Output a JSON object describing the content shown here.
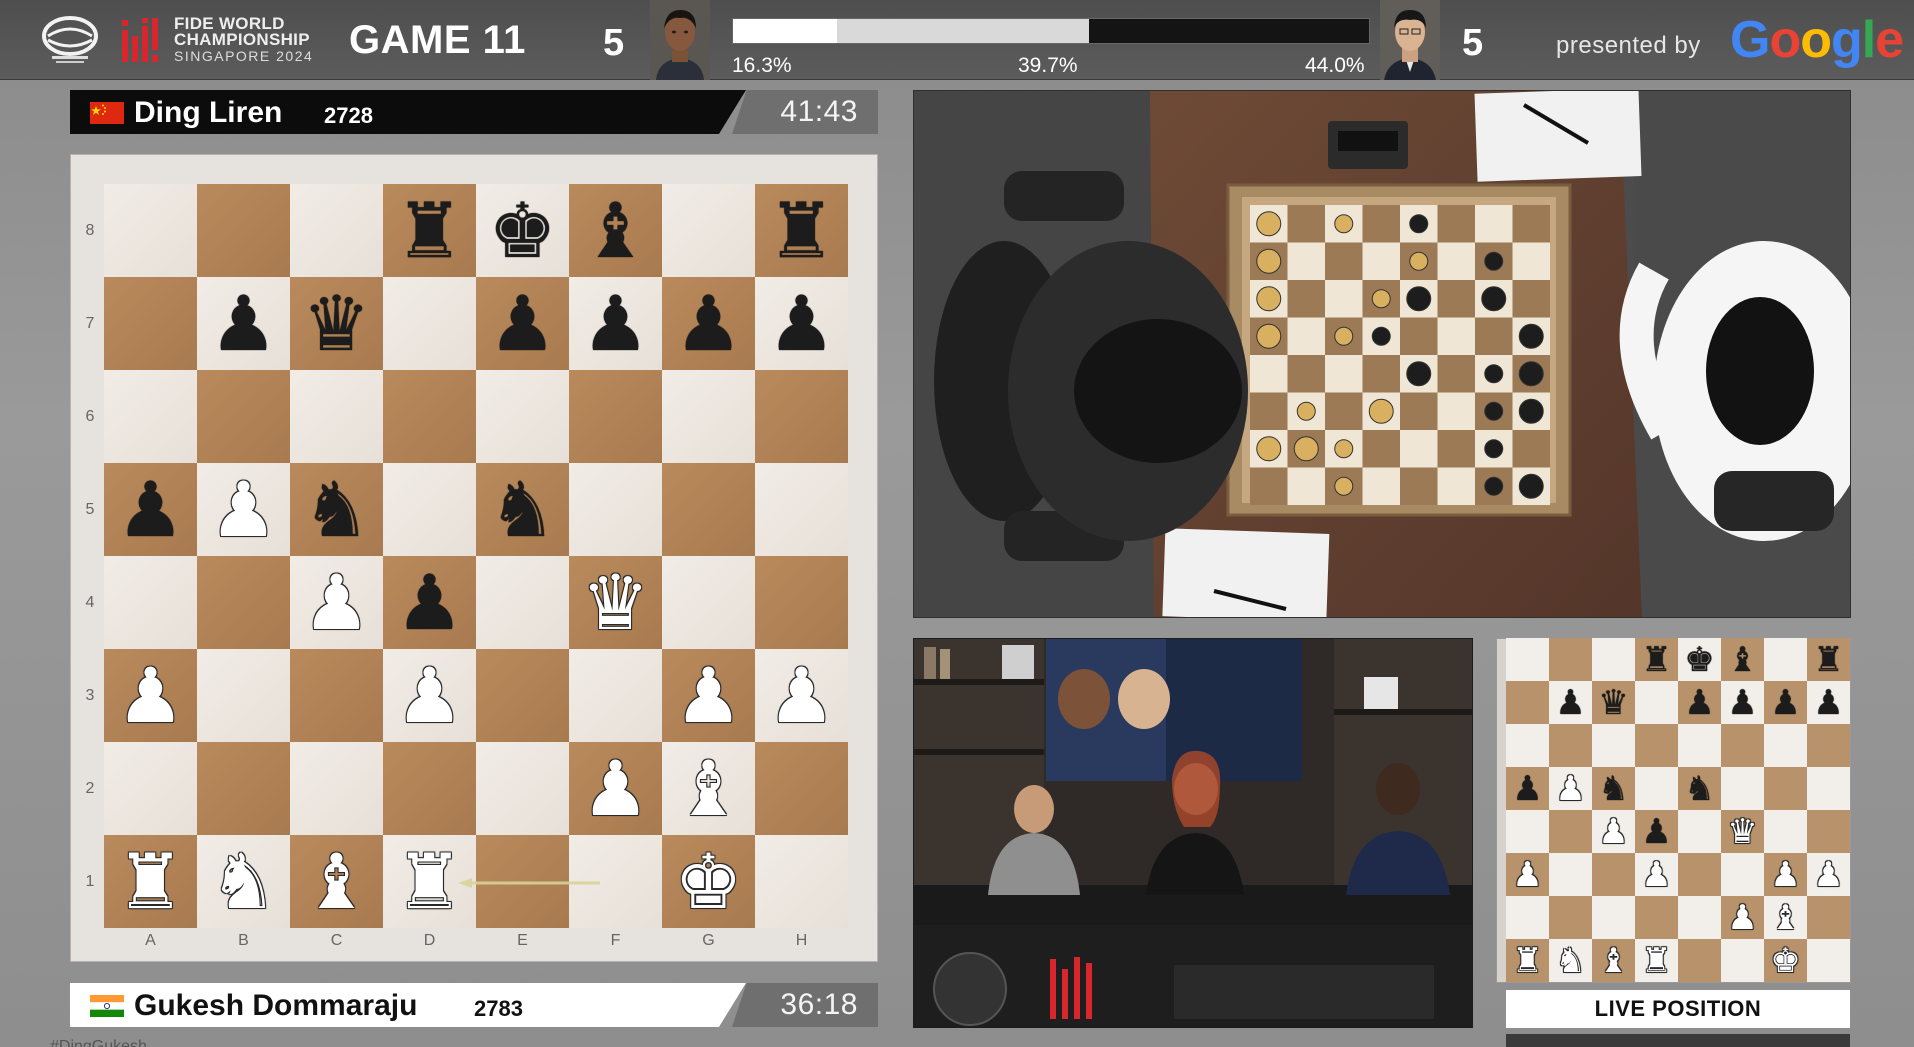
{
  "header": {
    "org_line1": "FIDE WORLD",
    "org_line2": "CHAMPIONSHIP",
    "org_line3": "SINGAPORE 2024",
    "game_label": "GAME 11",
    "score_left": "5",
    "score_right": "5",
    "presented_by": "presented by",
    "sponsor_letters": [
      "G",
      "o",
      "o",
      "g",
      "l",
      "e"
    ]
  },
  "evaluation": {
    "white_win_pct": 16.3,
    "draw_pct": 39.7,
    "black_win_pct": 44.0,
    "white_label": "16.3%",
    "draw_label": "39.7%",
    "black_label": "44.0%"
  },
  "players": {
    "top": {
      "name": "Ding Liren",
      "rating": "2728",
      "clock": "41:43",
      "flag_colors": [
        "#de2910",
        "#ffde00"
      ]
    },
    "bottom": {
      "name": "Gukesh Dommaraju",
      "rating": "2783",
      "clock": "36:18",
      "flag_colors": [
        "#ff9933",
        "#ffffff",
        "#138808"
      ]
    }
  },
  "board": {
    "files": [
      "A",
      "B",
      "C",
      "D",
      "E",
      "F",
      "G",
      "H"
    ],
    "ranks": [
      "8",
      "7",
      "6",
      "5",
      "4",
      "3",
      "2",
      "1"
    ],
    "position": [
      [
        "",
        "",
        "",
        "bR",
        "bK",
        "bB",
        "",
        "bR"
      ],
      [
        "",
        "bP",
        "bQ",
        "",
        "bP",
        "bP",
        "bP",
        "bP"
      ],
      [
        "",
        "",
        "",
        "",
        "",
        "",
        "",
        ""
      ],
      [
        "bP",
        "wP",
        "bN",
        "",
        "bN",
        "",
        "",
        ""
      ],
      [
        "",
        "",
        "wP",
        "bP",
        "",
        "wQ",
        "",
        ""
      ],
      [
        "wP",
        "",
        "",
        "wP",
        "",
        "",
        "wP",
        "wP"
      ],
      [
        "",
        "",
        "",
        "",
        "",
        "wP",
        "wB",
        ""
      ],
      [
        "wR",
        "wN",
        "wB",
        "wR",
        "",
        "",
        "wK",
        ""
      ]
    ],
    "last_move_arrow": {
      "from": "f1",
      "to": "d1",
      "color": "#d8d29a"
    }
  },
  "live_position": {
    "label": "LIVE POSITION"
  },
  "footer": {
    "hashtag": "#DingGukesh"
  },
  "colors": {
    "light_square": "#f1ece6",
    "dark_square": "#b98a5c",
    "eval_black": "#141414",
    "eval_white": "#ffffff"
  }
}
